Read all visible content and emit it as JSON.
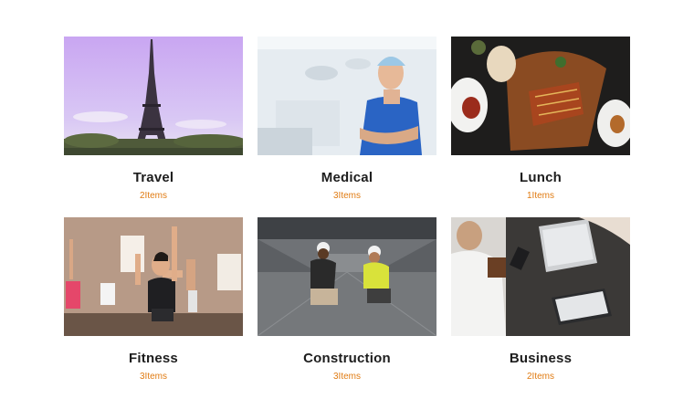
{
  "categories": [
    {
      "title": "Travel",
      "count": "2Items",
      "image": "eiffel-tower-photo"
    },
    {
      "title": "Medical",
      "count": "3Items",
      "image": "surgeon-photo"
    },
    {
      "title": "Lunch",
      "count": "1Items",
      "image": "food-platter-photo"
    },
    {
      "title": "Fitness",
      "count": "3Items",
      "image": "fitness-class-photo"
    },
    {
      "title": "Construction",
      "count": "3Items",
      "image": "construction-workers-photo"
    },
    {
      "title": "Business",
      "count": "2Items",
      "image": "business-desk-photo"
    }
  ],
  "colors": {
    "accent": "#e07b12",
    "title": "#1d1d1d",
    "background": "#ffffff"
  }
}
